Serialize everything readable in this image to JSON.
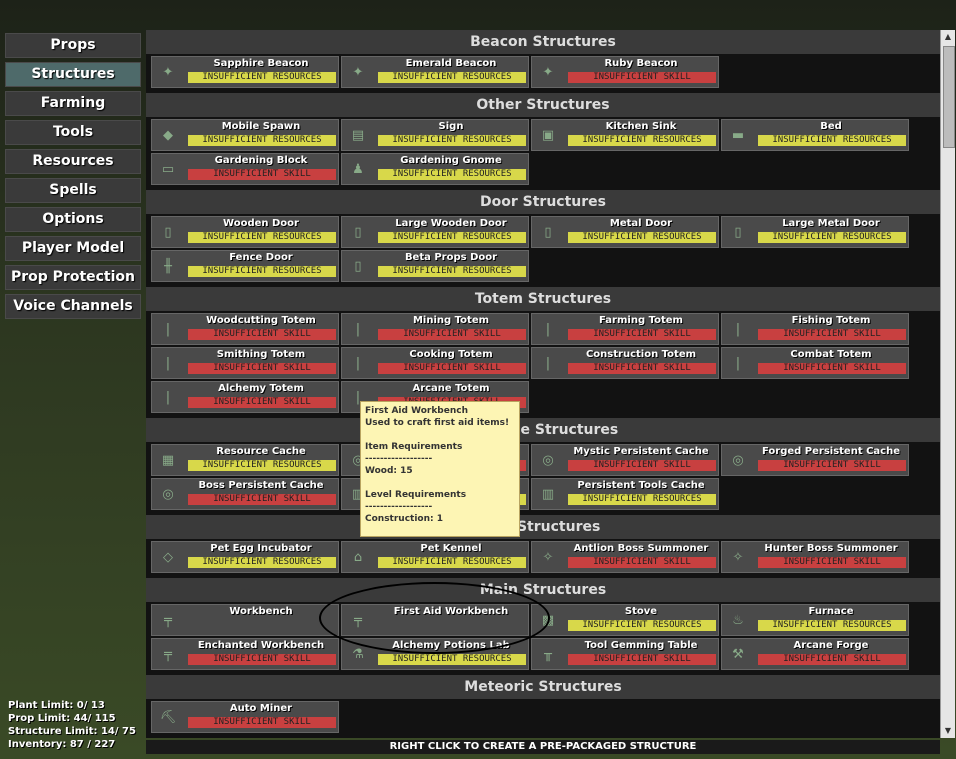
{
  "menu": [
    {
      "label": "Props"
    },
    {
      "label": "Structures"
    },
    {
      "label": "Farming"
    },
    {
      "label": "Tools"
    },
    {
      "label": "Resources"
    },
    {
      "label": "Spells"
    },
    {
      "label": "Options"
    },
    {
      "label": "Player Model"
    },
    {
      "label": "Prop Protection"
    },
    {
      "label": "Voice Channels"
    }
  ],
  "active_menu": "Structures",
  "stats": {
    "plant": "Plant Limit: 0/ 13",
    "prop": "Prop Limit: 44/ 115",
    "structure": "Structure Limit: 14/ 75",
    "inventory": "Inventory: 87 / 227"
  },
  "status_labels": {
    "res": "INSUFFICIENT RESOURCES",
    "skl": "INSUFFICIENT SKILL"
  },
  "sections": [
    {
      "title": "Beacon Structures",
      "top": 0,
      "items": [
        {
          "name": "Sapphire Beacon",
          "status": "res",
          "icon": "beacon-icon"
        },
        {
          "name": "Emerald Beacon",
          "status": "res",
          "icon": "beacon-icon"
        },
        {
          "name": "Ruby Beacon",
          "status": "skl",
          "icon": "beacon-icon"
        }
      ]
    },
    {
      "title": "Other Structures",
      "items": [
        {
          "name": "Mobile Spawn",
          "status": "res",
          "icon": "spawn-icon"
        },
        {
          "name": "Sign",
          "status": "res",
          "icon": "sign-icon"
        },
        {
          "name": "Kitchen Sink",
          "status": "res",
          "icon": "sink-icon"
        },
        {
          "name": "Bed",
          "status": "res",
          "icon": "bed-icon"
        },
        {
          "name": "Gardening Block",
          "status": "skl",
          "icon": "block-icon"
        },
        {
          "name": "Gardening Gnome",
          "status": "res",
          "icon": "gnome-icon"
        }
      ]
    },
    {
      "title": "Door Structures",
      "items": [
        {
          "name": "Wooden Door",
          "status": "res",
          "icon": "door-icon"
        },
        {
          "name": "Large Wooden Door",
          "status": "res",
          "icon": "door-icon"
        },
        {
          "name": "Metal Door",
          "status": "res",
          "icon": "door-icon"
        },
        {
          "name": "Large Metal Door",
          "status": "res",
          "icon": "door-icon"
        },
        {
          "name": "Fence Door",
          "status": "res",
          "icon": "fence-icon"
        },
        {
          "name": "Beta Props Door",
          "status": "res",
          "icon": "door-icon"
        }
      ]
    },
    {
      "title": "Totem Structures",
      "items": [
        {
          "name": "Woodcutting Totem",
          "status": "skl",
          "icon": "totem-icon"
        },
        {
          "name": "Mining Totem",
          "status": "skl",
          "icon": "totem-icon"
        },
        {
          "name": "Farming Totem",
          "status": "skl",
          "icon": "totem-icon"
        },
        {
          "name": "Fishing Totem",
          "status": "skl",
          "icon": "totem-icon"
        },
        {
          "name": "Smithing Totem",
          "status": "skl",
          "icon": "totem-icon"
        },
        {
          "name": "Cooking Totem",
          "status": "skl",
          "icon": "totem-icon"
        },
        {
          "name": "Construction Totem",
          "status": "skl",
          "icon": "totem-icon"
        },
        {
          "name": "Combat Totem",
          "status": "skl",
          "icon": "totem-icon"
        },
        {
          "name": "Alchemy Totem",
          "status": "skl",
          "icon": "totem-icon"
        },
        {
          "name": "Arcane Totem",
          "status": "skl",
          "icon": "totem-icon"
        }
      ]
    },
    {
      "title": "Storage Structures",
      "items": [
        {
          "name": "Resource Cache",
          "status": "res",
          "icon": "crate-icon"
        },
        {
          "name": "",
          "status": "skl",
          "icon": "cache-icon"
        },
        {
          "name": "Mystic Persistent Cache",
          "status": "skl",
          "icon": "cache-icon"
        },
        {
          "name": "Forged Persistent Cache",
          "status": "skl",
          "icon": "cache-icon"
        },
        {
          "name": "Boss Persistent Cache",
          "status": "skl",
          "icon": "cache-icon"
        },
        {
          "name": "",
          "status": "res",
          "icon": "chest-icon"
        },
        {
          "name": "Persistent Tools Cache",
          "status": "res",
          "icon": "chest-icon"
        }
      ]
    },
    {
      "title": "Pet Structures",
      "items": [
        {
          "name": "Pet Egg Incubator",
          "status": "res",
          "icon": "incubator-icon"
        },
        {
          "name": "Pet Kennel",
          "status": "res",
          "icon": "kennel-icon"
        },
        {
          "name": "Antlion Boss Summoner",
          "status": "skl",
          "icon": "summoner-icon"
        },
        {
          "name": "Hunter Boss Summoner",
          "status": "skl",
          "icon": "summoner-icon"
        }
      ]
    },
    {
      "title": "Main Structures",
      "items": [
        {
          "name": "Workbench",
          "status": "",
          "icon": "workbench-icon"
        },
        {
          "name": "First Aid Workbench",
          "status": "",
          "icon": "workbench-icon"
        },
        {
          "name": "Stove",
          "status": "res",
          "icon": "stove-icon"
        },
        {
          "name": "Furnace",
          "status": "res",
          "icon": "furnace-icon"
        },
        {
          "name": "Enchanted Workbench",
          "status": "skl",
          "icon": "workbench-icon"
        },
        {
          "name": "Alchemy Potions Lab",
          "status": "res",
          "icon": "lab-icon"
        },
        {
          "name": "Tool Gemming Table",
          "status": "skl",
          "icon": "table-icon"
        },
        {
          "name": "Arcane Forge",
          "status": "skl",
          "icon": "forge-icon"
        }
      ]
    },
    {
      "title": "Meteoric Structures",
      "items": [
        {
          "name": "Auto Miner",
          "status": "skl",
          "icon": "miner-icon"
        }
      ]
    }
  ],
  "footer": "RIGHT CLICK TO CREATE A PRE-PACKAGED STRUCTURE",
  "tooltip": {
    "title": "First Aid Workbench",
    "desc": "Used to craft first aid items!",
    "item_req": "Item Requirements",
    "sep1": "------------------",
    "wood": "Wood: 15",
    "level_req": "Level Requirements",
    "sep2": "------------------",
    "construction": "Construction: 1"
  }
}
